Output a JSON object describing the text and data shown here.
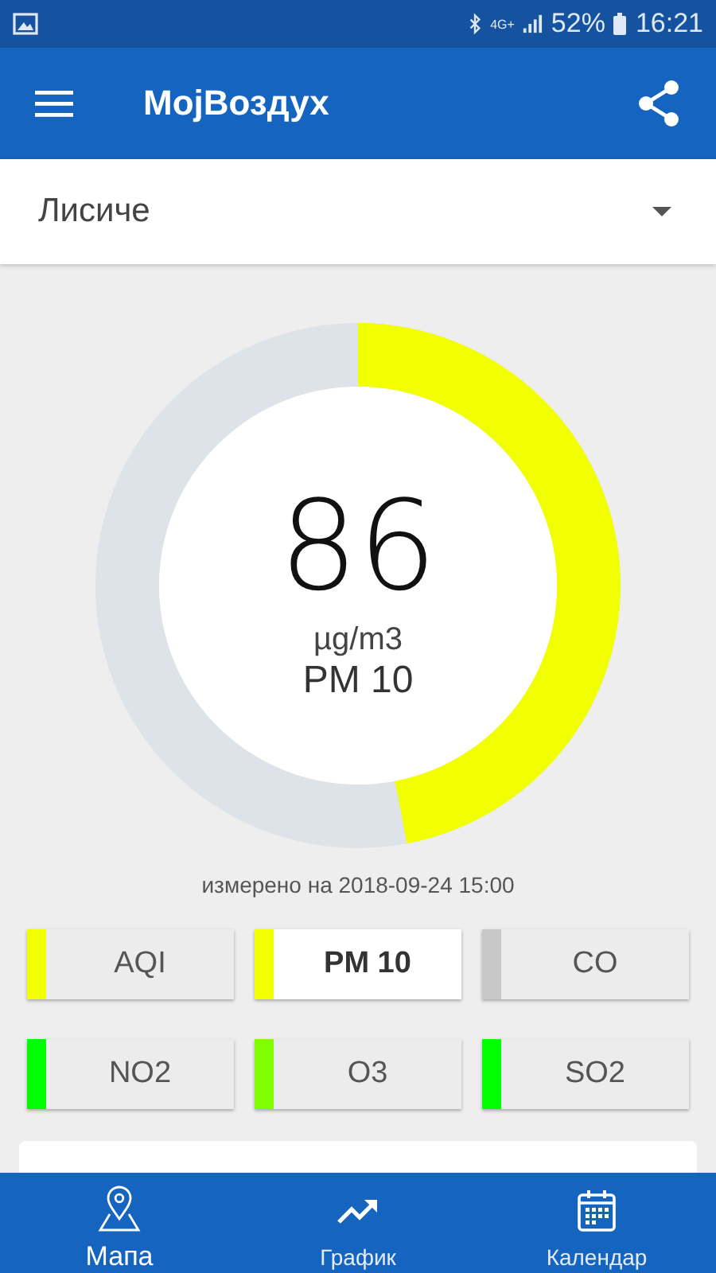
{
  "status_bar": {
    "battery": "52%",
    "time": "16:21",
    "network": "4G+"
  },
  "app_bar": {
    "title": "МојВоздух"
  },
  "location_select": {
    "value": "Лисиче"
  },
  "gauge": {
    "level": 0.47,
    "color": "#f2ff00",
    "value": "86",
    "unit": "µg/m3",
    "pollutant": "PM 10"
  },
  "measured_at": "измерено на 2018-09-24 15:00",
  "pollutants": [
    {
      "label": "AQI",
      "color": "#f2ff00",
      "selected": false
    },
    {
      "label": "PM 10",
      "color": "#f2ff00",
      "selected": true
    },
    {
      "label": "CO",
      "color": "#c8c8c8",
      "selected": false
    },
    {
      "label": "NO2",
      "color": "#00ff00",
      "selected": false
    },
    {
      "label": "O3",
      "color": "#80ff00",
      "selected": false
    },
    {
      "label": "SO2",
      "color": "#00ff00",
      "selected": false
    }
  ],
  "bottom_nav": [
    {
      "label": "Мапа",
      "kind": "map",
      "selected": true
    },
    {
      "label": "График",
      "kind": "chart",
      "selected": false
    },
    {
      "label": "Календар",
      "kind": "calendar",
      "selected": false
    }
  ]
}
